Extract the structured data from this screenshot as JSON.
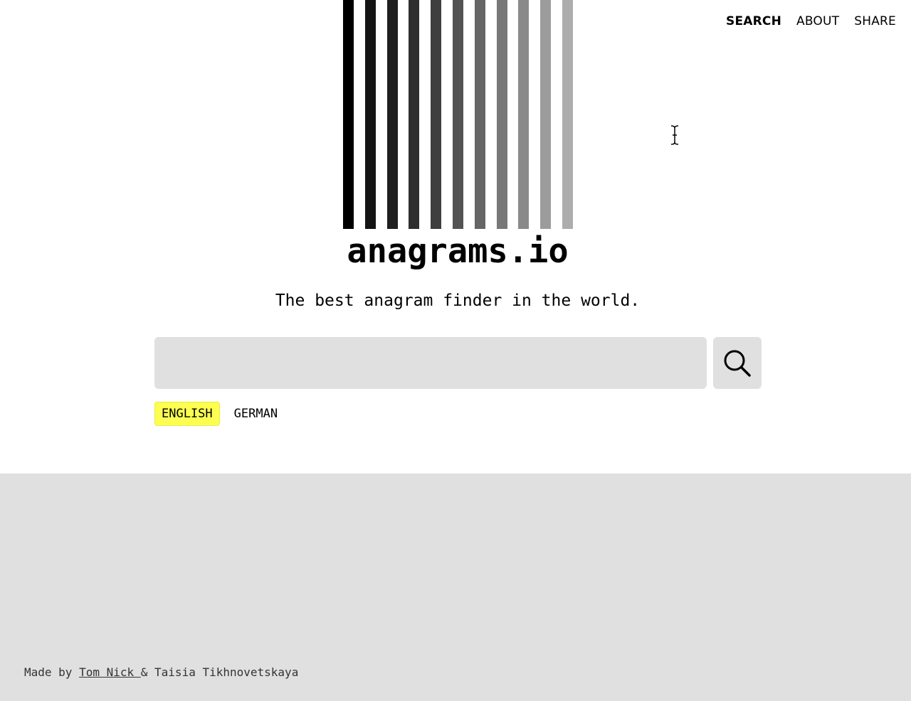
{
  "nav": {
    "items": [
      {
        "label": "SEARCH",
        "active": true
      },
      {
        "label": "ABOUT",
        "active": false
      },
      {
        "label": "SHARE",
        "active": false
      }
    ]
  },
  "logo": {
    "bar_colors": [
      "#000000",
      "#141414",
      "#1f1f1f",
      "#2e2e2e",
      "#3f3f3f",
      "#535353",
      "#666666",
      "#787878",
      "#8a8a8a",
      "#9c9c9c",
      "#adadad"
    ]
  },
  "header": {
    "title": "anagrams.io",
    "tagline": "The best anagram finder in the world."
  },
  "search": {
    "value": "",
    "placeholder": "",
    "button_icon": "search-icon"
  },
  "languages": [
    {
      "label": "ENGLISH",
      "active": true
    },
    {
      "label": "GERMAN",
      "active": false
    }
  ],
  "colors": {
    "accent": "#fcff52",
    "panel": "#e0e0e0"
  },
  "footer": {
    "prefix": "Made by ",
    "author1": "Tom Nick ",
    "separator": "& ",
    "author2": "Taisia Tikhnovetskaya"
  }
}
